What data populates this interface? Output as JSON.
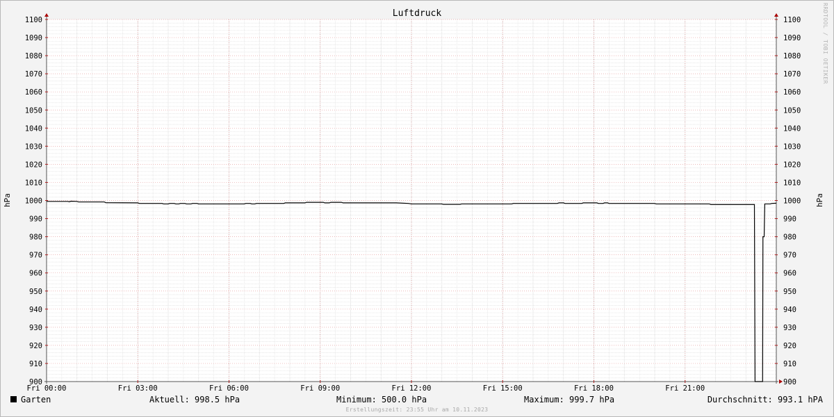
{
  "chart_data": {
    "type": "line",
    "title": "Luftdruck",
    "ylabel": "hPa",
    "ylim": [
      900,
      1100
    ],
    "ytick_step": 10,
    "xlim_hours": [
      0,
      24
    ],
    "x_ticks": [
      {
        "hour": 0,
        "label": "Fri 00:00"
      },
      {
        "hour": 3,
        "label": "Fri 03:00"
      },
      {
        "hour": 6,
        "label": "Fri 06:00"
      },
      {
        "hour": 9,
        "label": "Fri 09:00"
      },
      {
        "hour": 12,
        "label": "Fri 12:00"
      },
      {
        "hour": 15,
        "label": "Fri 15:00"
      },
      {
        "hour": 18,
        "label": "Fri 18:00"
      },
      {
        "hour": 21,
        "label": "Fri 21:00"
      }
    ],
    "grid": true,
    "series": [
      {
        "name": "Garten",
        "color": "#000000",
        "points": [
          [
            0,
            999.5
          ],
          [
            0.7,
            999.5
          ],
          [
            0.75,
            999.3
          ],
          [
            0.8,
            999.6
          ],
          [
            1.0,
            999.5
          ],
          [
            1.05,
            999.2
          ],
          [
            1.9,
            999.2
          ],
          [
            1.95,
            998.8
          ],
          [
            3.0,
            998.7
          ],
          [
            3.05,
            998.4
          ],
          [
            3.8,
            998.4
          ],
          [
            3.85,
            998.1
          ],
          [
            4.0,
            998.1
          ],
          [
            4.05,
            998.4
          ],
          [
            4.2,
            998.4
          ],
          [
            4.25,
            998.1
          ],
          [
            4.35,
            998.1
          ],
          [
            4.4,
            998.4
          ],
          [
            4.55,
            998.4
          ],
          [
            4.6,
            998.1
          ],
          [
            4.75,
            998.1
          ],
          [
            4.8,
            998.4
          ],
          [
            4.95,
            998.4
          ],
          [
            5.0,
            998.1
          ],
          [
            6.5,
            998.1
          ],
          [
            6.55,
            998.4
          ],
          [
            6.7,
            998.4
          ],
          [
            6.75,
            998.1
          ],
          [
            6.85,
            998.1
          ],
          [
            6.9,
            998.4
          ],
          [
            7.8,
            998.4
          ],
          [
            7.85,
            998.7
          ],
          [
            8.5,
            998.7
          ],
          [
            8.55,
            999.0
          ],
          [
            9.1,
            999.0
          ],
          [
            9.15,
            998.7
          ],
          [
            9.3,
            998.7
          ],
          [
            9.35,
            999.0
          ],
          [
            9.7,
            999.0
          ],
          [
            9.75,
            998.7
          ],
          [
            11.5,
            998.7
          ],
          [
            11.9,
            998.4
          ],
          [
            12.0,
            998.1
          ],
          [
            13.0,
            998.1
          ],
          [
            13.05,
            997.9
          ],
          [
            13.6,
            997.9
          ],
          [
            13.65,
            998.1
          ],
          [
            15.3,
            998.1
          ],
          [
            15.35,
            998.4
          ],
          [
            16.8,
            998.4
          ],
          [
            16.85,
            998.7
          ],
          [
            17.0,
            998.7
          ],
          [
            17.05,
            998.4
          ],
          [
            17.6,
            998.4
          ],
          [
            17.65,
            998.7
          ],
          [
            18.1,
            998.7
          ],
          [
            18.15,
            998.4
          ],
          [
            18.3,
            998.4
          ],
          [
            18.35,
            998.7
          ],
          [
            18.45,
            998.7
          ],
          [
            18.5,
            998.4
          ],
          [
            20.0,
            998.4
          ],
          [
            20.05,
            998.1
          ],
          [
            21.8,
            998.1
          ],
          [
            21.85,
            997.8
          ],
          [
            23.28,
            997.8
          ],
          [
            23.3,
            900
          ],
          [
            23.55,
            900
          ],
          [
            23.56,
            980
          ],
          [
            23.6,
            980
          ],
          [
            23.62,
            998.1
          ],
          [
            23.8,
            998.1
          ],
          [
            23.85,
            998.4
          ],
          [
            24.0,
            998.5
          ]
        ]
      }
    ]
  },
  "legend": {
    "series_label": "Garten",
    "current": "Aktuell: 998.5 hPa",
    "minimum": "Minimum: 500.0 hPa",
    "maximum": "Maximum: 999.7 hPa",
    "average": "Durchschnitt: 993.1 hPA"
  },
  "footer": {
    "created": "Erstellungszeit: 23:55 Uhr am 10.11.2023"
  },
  "watermark": "RRDTOOL / TOBI OETIKER"
}
